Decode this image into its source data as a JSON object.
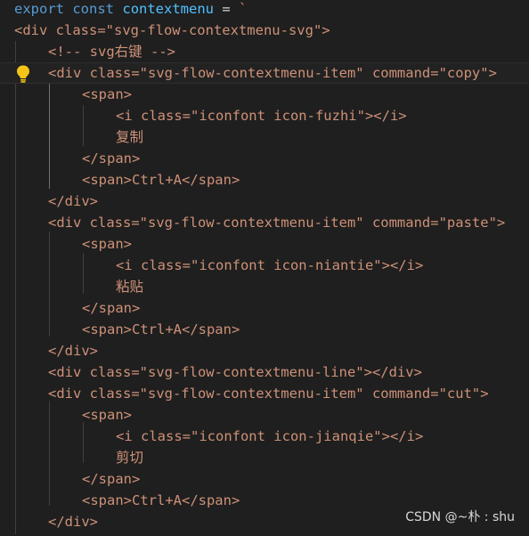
{
  "editor": {
    "export_kw": "export",
    "const_kw": "const",
    "var_name": "contextmenu",
    "equals": " = ",
    "backtick": "`",
    "lines": [
      "<div class=\"svg-flow-contextmenu-svg\">",
      "<!-- svg右键 -->",
      "<div class=\"svg-flow-contextmenu-item\" command=\"copy\">",
      "<span>",
      "<i class=\"iconfont icon-fuzhi\"></i>",
      "复制",
      "</span>",
      "<span>Ctrl+A</span>",
      "</div>",
      "<div class=\"svg-flow-contextmenu-item\" command=\"paste\">",
      "<span>",
      "<i class=\"iconfont icon-niantie\"></i>",
      "粘贴",
      "</span>",
      "<span>Ctrl+A</span>",
      "</div>",
      "<div class=\"svg-flow-contextmenu-line\"></div>",
      "<div class=\"svg-flow-contextmenu-item\" command=\"cut\">",
      "<span>",
      "<i class=\"iconfont icon-jianqie\"></i>",
      "剪切",
      "</span>",
      "<span>Ctrl+A</span>",
      "</div>"
    ]
  },
  "watermark": "CSDN @~朴 : shu",
  "colors": {
    "background": "#1f1f1f",
    "keyword": "#569cd6",
    "identifier": "#4fc1ff",
    "string": "#ce9178",
    "attribute": "#9cdcfe",
    "lightbulb": "#f5c518"
  },
  "icons": [
    "lightbulb-icon"
  ]
}
